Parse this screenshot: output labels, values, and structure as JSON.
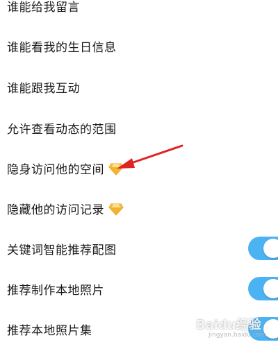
{
  "settings": {
    "items": [
      {
        "label": "谁能给我留言",
        "vip": false,
        "toggle": null
      },
      {
        "label": "谁能看我的生日信息",
        "vip": false,
        "toggle": null
      },
      {
        "label": "谁能跟我互动",
        "vip": false,
        "toggle": null
      },
      {
        "label": "允许查看动态的范围",
        "vip": false,
        "toggle": null
      },
      {
        "label": "隐身访问他的空间",
        "vip": true,
        "toggle": null
      },
      {
        "label": "隐藏他的访问记录",
        "vip": true,
        "toggle": null
      },
      {
        "label": "关键词智能推荐配图",
        "vip": false,
        "toggle": true
      },
      {
        "label": "推荐制作本地照片",
        "vip": false,
        "toggle": true
      },
      {
        "label": "推荐本地照片集",
        "vip": false,
        "toggle": true
      }
    ]
  },
  "colors": {
    "toggle_on": "#4cb3f3",
    "arrow": "#e02424",
    "diamond": "#f7c244"
  },
  "watermark": {
    "text": "Baidu经验",
    "sub": "jingyan.baidu.com"
  }
}
